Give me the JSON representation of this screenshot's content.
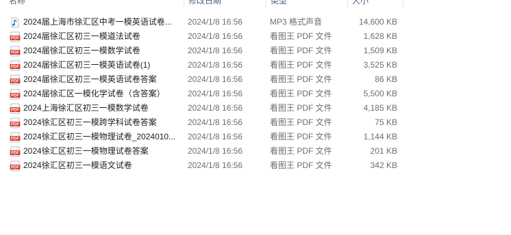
{
  "columns": {
    "name": "名称",
    "date": "修改日期",
    "type": "类型",
    "size": "大小"
  },
  "files": [
    {
      "icon": "audio-file-icon",
      "name": "2024届上海市徐汇区中考一模英语试卷...",
      "date": "2024/1/8 16:56",
      "type": "MP3 格式声音",
      "size": "14,600 KB"
    },
    {
      "icon": "pdf-file-icon",
      "name": "2024届徐汇区初三一模道法试卷",
      "date": "2024/1/8 16:56",
      "type": "看图王 PDF 文件",
      "size": "1,628 KB"
    },
    {
      "icon": "pdf-file-icon",
      "name": "2024届徐汇区初三一模数学试卷",
      "date": "2024/1/8 16:56",
      "type": "看图王 PDF 文件",
      "size": "1,509 KB"
    },
    {
      "icon": "pdf-file-icon",
      "name": "2024届徐汇区初三一模英语试卷(1)",
      "date": "2024/1/8 16:56",
      "type": "看图王 PDF 文件",
      "size": "3,525 KB"
    },
    {
      "icon": "pdf-file-icon",
      "name": "2024届徐汇区初三一模英语试卷答案",
      "date": "2024/1/8 16:56",
      "type": "看图王 PDF 文件",
      "size": "86 KB"
    },
    {
      "icon": "pdf-file-icon",
      "name": "2024届徐汇区一模化学试卷（含答案）",
      "date": "2024/1/8 16:56",
      "type": "看图王 PDF 文件",
      "size": "5,500 KB"
    },
    {
      "icon": "pdf-file-icon",
      "name": "2024上海徐汇区初三一模数学试卷",
      "date": "2024/1/8 16:56",
      "type": "看图王 PDF 文件",
      "size": "4,185 KB"
    },
    {
      "icon": "pdf-file-icon",
      "name": "2024徐汇区初三一模跨学科试卷答案",
      "date": "2024/1/8 16:56",
      "type": "看图王 PDF 文件",
      "size": "75 KB"
    },
    {
      "icon": "pdf-file-icon",
      "name": "2024徐汇区初三一模物理试卷_2024010...",
      "date": "2024/1/8 16:56",
      "type": "看图王 PDF 文件",
      "size": "1,144 KB"
    },
    {
      "icon": "pdf-file-icon",
      "name": "2024徐汇区初三一模物理试卷答案",
      "date": "2024/1/8 16:56",
      "type": "看图王 PDF 文件",
      "size": "201 KB"
    },
    {
      "icon": "pdf-file-icon",
      "name": "2024徐汇区初三一模语文试卷",
      "date": "2024/1/8 16:56",
      "type": "看图王 PDF 文件",
      "size": "342 KB"
    }
  ],
  "colors": {
    "pdf_icon": "#d23b2c",
    "audio_icon": "#2a6fc9"
  }
}
